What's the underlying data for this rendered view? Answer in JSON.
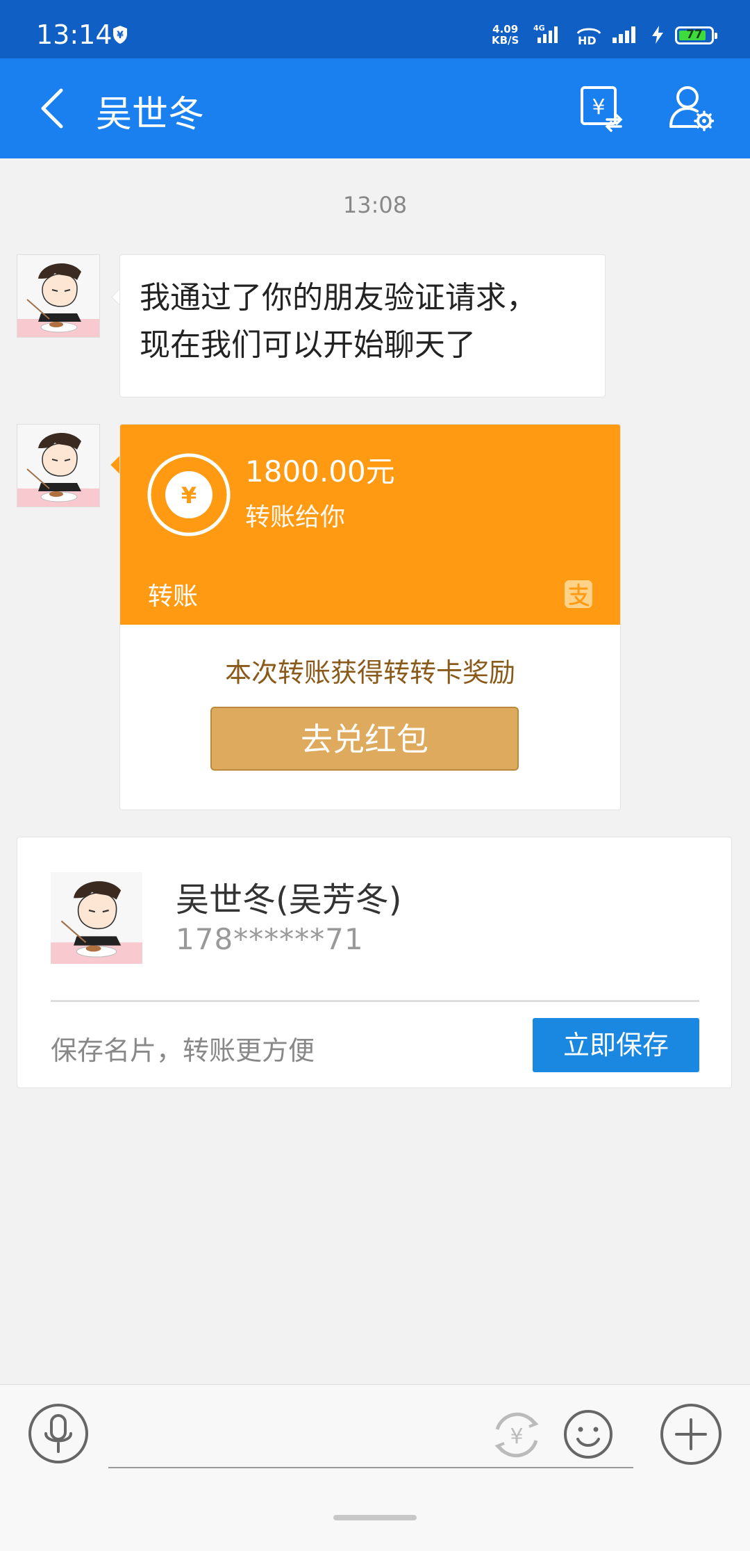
{
  "status_bar": {
    "time": "13:14",
    "speed_value": "4.09",
    "speed_unit": "KB/S",
    "network": "4G",
    "hd": "HD",
    "battery": "77"
  },
  "header": {
    "title": "吴世冬"
  },
  "chat": {
    "timestamp": "13:08",
    "message1_line1": "我通过了你的朋友验证请求，",
    "message1_line2": "现在我们可以开始聊天了",
    "transfer": {
      "amount": "1800.00元",
      "subtitle": "转账给你",
      "label": "转账",
      "reward_text": "本次转账获得转转卡奖励",
      "redeem_button": "去兑红包"
    }
  },
  "contact_card": {
    "name": "吴世冬(吴芳冬)",
    "phone": "178******71",
    "hint": "保存名片，转账更方便",
    "save_button": "立即保存"
  },
  "colors": {
    "header_blue": "#1a80f0",
    "statusbar_blue": "#0f5fc4",
    "transfer_orange": "#ff9a12",
    "redeem_gold": "#ddaa5e",
    "save_blue": "#1a88e0"
  },
  "icons": [
    "back-arrow-icon",
    "transfer-yen-icon",
    "user-settings-icon",
    "alipay-logo-icon",
    "microphone-icon",
    "yen-circle-icon",
    "smiley-icon",
    "plus-icon"
  ]
}
